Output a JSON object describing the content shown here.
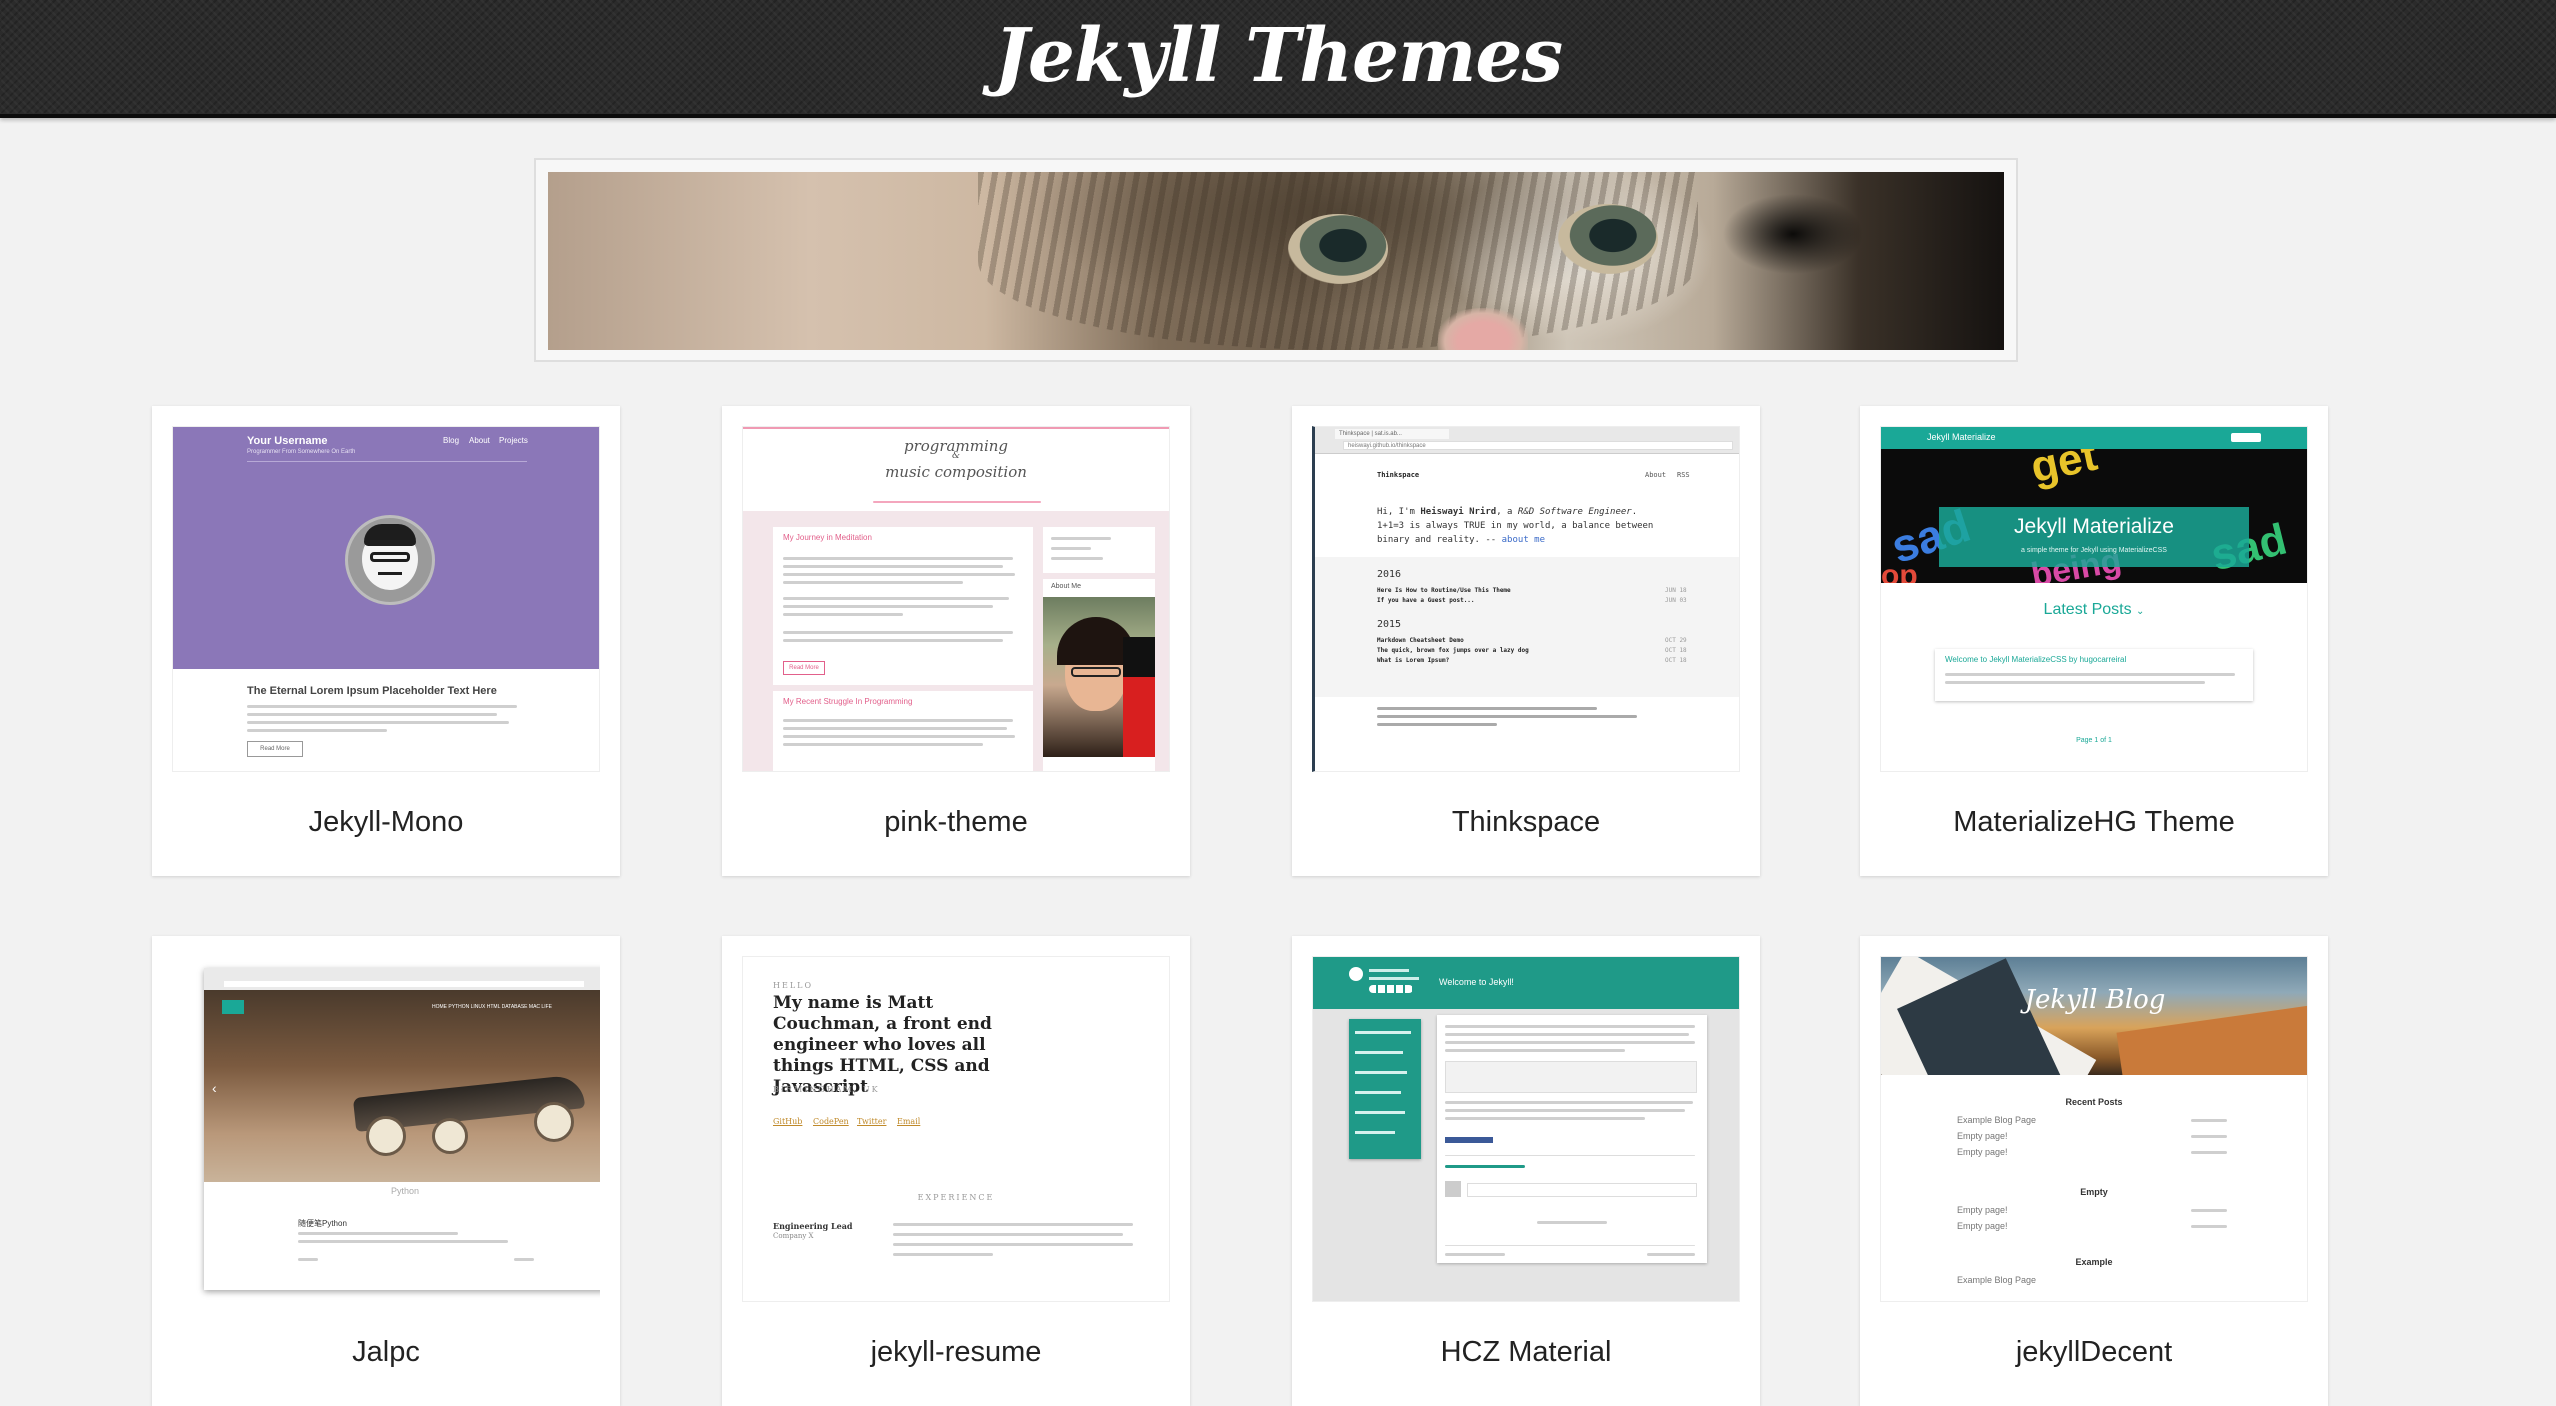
{
  "header": {
    "title": "Jekyll Themes"
  },
  "themes": [
    {
      "name": "Jekyll-Mono"
    },
    {
      "name": "pink-theme"
    },
    {
      "name": "Thinkspace"
    },
    {
      "name": "MaterializeHG Theme"
    },
    {
      "name": "Jalpc"
    },
    {
      "name": "jekyll-resume"
    },
    {
      "name": "HCZ Material"
    },
    {
      "name": "jekyllDecent"
    }
  ],
  "previews": {
    "mono": {
      "username": "Your Username",
      "tagline": "Programmer From Somewhere On Earth",
      "nav": [
        "Blog",
        "About",
        "Projects"
      ],
      "post_title": "The Eternal Lorem Ipsum Placeholder Text Here",
      "read_more": "Read More"
    },
    "pink": {
      "title_line1": "programming",
      "title_line2": "&",
      "title_line3": "music composition",
      "post1": "My Journey in Meditation",
      "post2": "My Recent Struggle In Programming",
      "about": "About Me",
      "read_more": "Read More"
    },
    "thinkspace": {
      "tab": "Thinkspace | sat.is.ab...",
      "url": "heiswayi.github.io/thinkspace",
      "brand": "Thinkspace",
      "nav": [
        "About",
        "RSS"
      ],
      "intro_1": "Hi, I'm",
      "intro_name": "Heiswayi Nrird",
      "intro_2": ", a",
      "intro_role": "R&D Software Engineer",
      "intro_3": ".",
      "line2": "1+1=3 is always TRUE in my world, a balance between",
      "line3": "binary and reality. --",
      "about_link": "about me",
      "year1": "2016",
      "year2": "2015",
      "posts_2016": [
        "Here Is How to Routine/Use This Theme",
        "If you have a Guest post..."
      ],
      "posts_2015": [
        "Markdown Cheatsheet Demo",
        "The quick, brown fox jumps over a lazy dog",
        "What is Lorem Ipsum?"
      ],
      "dates": [
        "JUN 18",
        "JUN 03",
        "OCT 29",
        "OCT 18",
        "OCT 18"
      ]
    },
    "materialize": {
      "brand": "Jekyll Materialize",
      "hero_title": "Jekyll Materialize",
      "hero_sub": "a simple theme for Jekyll using MaterializeCSS",
      "latest": "Latest Posts",
      "post": "Welcome to Jekyll MaterializeCSS by hugocarreiral",
      "pager": "Page 1 of 1"
    },
    "jalpc": {
      "nav": [
        "HOME",
        "PYTHON",
        "LINUX",
        "HTML",
        "DATABASE",
        "MAC",
        "LIFE"
      ],
      "section": "Python",
      "post": "随便笔Python"
    },
    "resume": {
      "hello": "HELLO",
      "intro": "My name is Matt Couchman, a front end engineer who loves all things HTML, CSS and Javascript",
      "location": "BIRMINGHAM, UK",
      "links": [
        "GitHub",
        "CodePen",
        "Twitter",
        "Email"
      ],
      "experience": "EXPERIENCE",
      "job": "Engineering Lead",
      "company": "Company X"
    },
    "hcz": {
      "welcome": "Welcome to Jekyll!"
    },
    "decent": {
      "hero": "Jekyll Blog",
      "recent": "Recent Posts",
      "empty": "Empty",
      "example": "Example",
      "items1": [
        "Example Blog Page",
        "Empty page!",
        "Empty page!"
      ],
      "items2": [
        "Empty page!",
        "Empty page!"
      ],
      "items3": [
        "Example Blog Page"
      ]
    }
  }
}
